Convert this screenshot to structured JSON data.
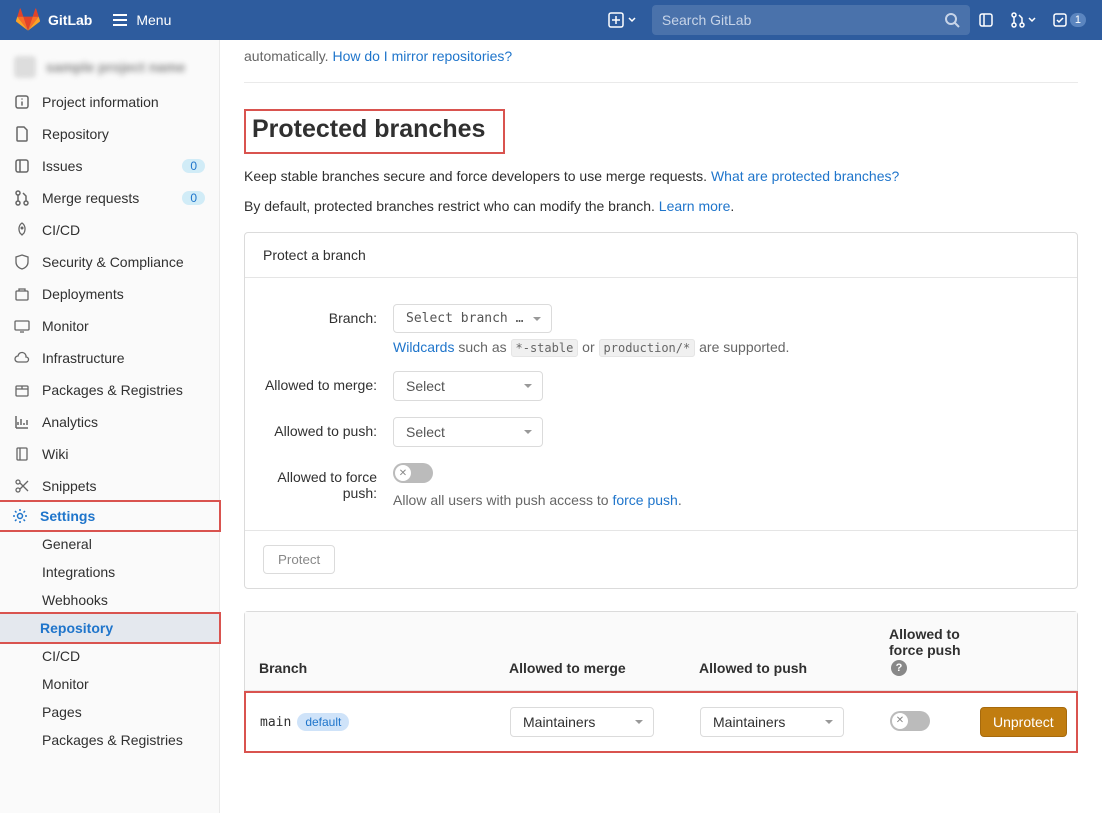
{
  "topbar": {
    "brand": "GitLab",
    "menu": "Menu",
    "search_placeholder": "Search GitLab",
    "todo_count": "1"
  },
  "sidebar": {
    "items": [
      {
        "label": "Project information"
      },
      {
        "label": "Repository"
      },
      {
        "label": "Issues",
        "badge": "0"
      },
      {
        "label": "Merge requests",
        "badge": "0"
      },
      {
        "label": "CI/CD"
      },
      {
        "label": "Security & Compliance"
      },
      {
        "label": "Deployments"
      },
      {
        "label": "Monitor"
      },
      {
        "label": "Infrastructure"
      },
      {
        "label": "Packages & Registries"
      },
      {
        "label": "Analytics"
      },
      {
        "label": "Wiki"
      },
      {
        "label": "Snippets"
      },
      {
        "label": "Settings"
      }
    ],
    "settings_sub": [
      {
        "label": "General"
      },
      {
        "label": "Integrations"
      },
      {
        "label": "Webhooks"
      },
      {
        "label": "Repository"
      },
      {
        "label": "CI/CD"
      },
      {
        "label": "Monitor"
      },
      {
        "label": "Pages"
      },
      {
        "label": "Packages & Registries"
      }
    ]
  },
  "intro": {
    "tail": "automatically. ",
    "link": "How do I mirror repositories?"
  },
  "section": {
    "title": "Protected branches",
    "desc1": "Keep stable branches secure and force developers to use merge requests. ",
    "link1": "What are protected branches?",
    "desc2": "By default, protected branches restrict who can modify the branch. ",
    "link2": "Learn more"
  },
  "protect_card": {
    "header": "Protect a branch",
    "branch_label": "Branch:",
    "branch_placeholder": "Select branch …",
    "wildcards_link": "Wildcards",
    "wildcards_mid": " such as ",
    "code1": "*-stable",
    "or": " or ",
    "code2": "production/*",
    "wildcards_end": " are supported.",
    "merge_label": "Allowed to merge:",
    "merge_placeholder": "Select",
    "push_label": "Allowed to push:",
    "push_placeholder": "Select",
    "force_label": "Allowed to force push:",
    "force_help_pre": "Allow all users with push access to ",
    "force_help_link": "force push",
    "protect_btn": "Protect"
  },
  "table": {
    "head": {
      "branch": "Branch",
      "merge": "Allowed to merge",
      "push": "Allowed to push",
      "force": "Allowed to force push"
    },
    "row": {
      "branch": "main",
      "default": "default",
      "merge": "Maintainers",
      "push": "Maintainers",
      "unprotect": "Unprotect"
    }
  }
}
